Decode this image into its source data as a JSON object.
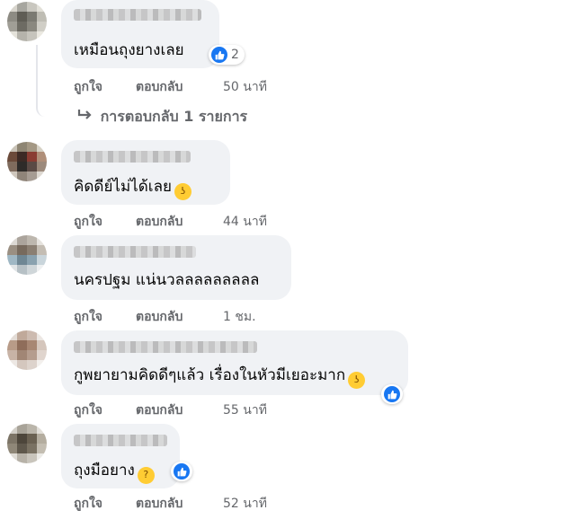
{
  "comments": [
    {
      "text": "เหมือนถุงยางเลย",
      "like_label": "ถูกใจ",
      "reply_label": "ตอบกลับ",
      "time": "50 นาที",
      "reaction_count": "2"
    },
    {
      "text": "คิดดีย์ไม่ได้เลย",
      "like_label": "ถูกใจ",
      "reply_label": "ตอบกลับ",
      "time": "44 นาที"
    },
    {
      "text": "นครปฐม แน่นวลลลลลลลลล",
      "like_label": "ถูกใจ",
      "reply_label": "ตอบกลับ",
      "time": "1 ชม."
    },
    {
      "text": "กูพยายามคิดดีๆแล้ว เรื่องในหัวมีเยอะมาก",
      "like_label": "ถูกใจ",
      "reply_label": "ตอบกลับ",
      "time": "55 นาที"
    },
    {
      "text": "ถุงมือยาง",
      "like_label": "ถูกใจ",
      "reply_label": "ตอบกลับ",
      "time": "52 นาที"
    }
  ],
  "replies_link": "การตอบกลับ 1 รายการ",
  "icons": {
    "like": "thumbs-up-icon",
    "reply_arrow": "reply-arrow-icon"
  },
  "colors": {
    "facebook_blue": "#1877f2",
    "bubble_bg": "#f0f2f5",
    "secondary_text": "#65676b"
  }
}
